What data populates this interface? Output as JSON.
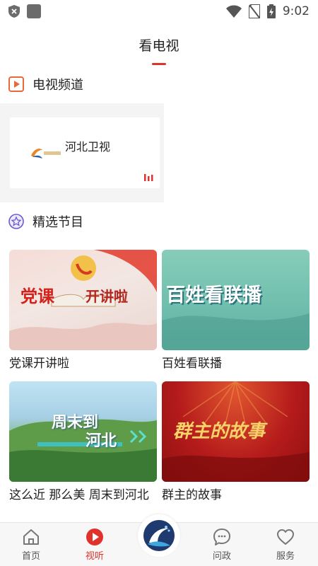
{
  "status_bar": {
    "time": "9:02"
  },
  "header": {
    "title": "看电视"
  },
  "channels_section": {
    "title": "电视频道",
    "channels": [
      {
        "name": "河北卫视"
      }
    ]
  },
  "programs_section": {
    "title": "精选节目",
    "programs": [
      {
        "title": "党课开讲啦",
        "thumb_text_1": "党课",
        "thumb_text_2": "开讲啦"
      },
      {
        "title": "百姓看联播",
        "thumb_text_1": "百姓看联播"
      },
      {
        "title": "这么近 那么美 周末到河北",
        "thumb_text_1": "周末到",
        "thumb_text_2": "河北"
      },
      {
        "title": "群主的故事",
        "thumb_text_1": "群主的故事"
      }
    ]
  },
  "bottom_nav": {
    "items": [
      {
        "label": "首页"
      },
      {
        "label": "视听"
      },
      {
        "label": "问政"
      },
      {
        "label": "服务"
      }
    ],
    "active_color": "#e0322c"
  }
}
